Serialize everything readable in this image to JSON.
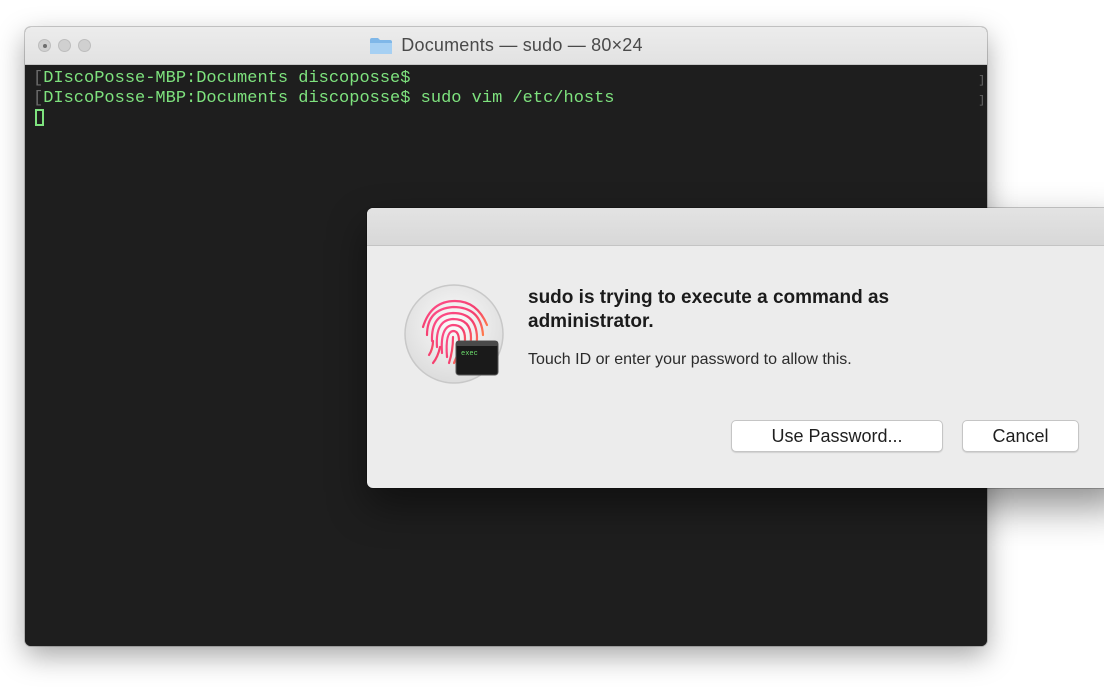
{
  "terminal": {
    "title": "Documents — sudo — 80×24",
    "lines": [
      {
        "mark": "[",
        "text": "DIscoPosse-MBP:Documents discoposse$",
        "right_mark": "]"
      },
      {
        "mark": "[",
        "text": "DIscoPosse-MBP:Documents discoposse$ sudo vim /etc/hosts",
        "right_mark": "]"
      }
    ],
    "colors": {
      "background": "#1e1e1e",
      "text": "#7ee27e"
    }
  },
  "dialog": {
    "heading": "sudo is trying to execute a command as administrator.",
    "message": "Touch ID or enter your password to allow this.",
    "icon_badge_text": "exec",
    "icon": "touch-id-fingerprint-icon",
    "buttons": {
      "use_password": "Use Password...",
      "cancel": "Cancel"
    }
  }
}
